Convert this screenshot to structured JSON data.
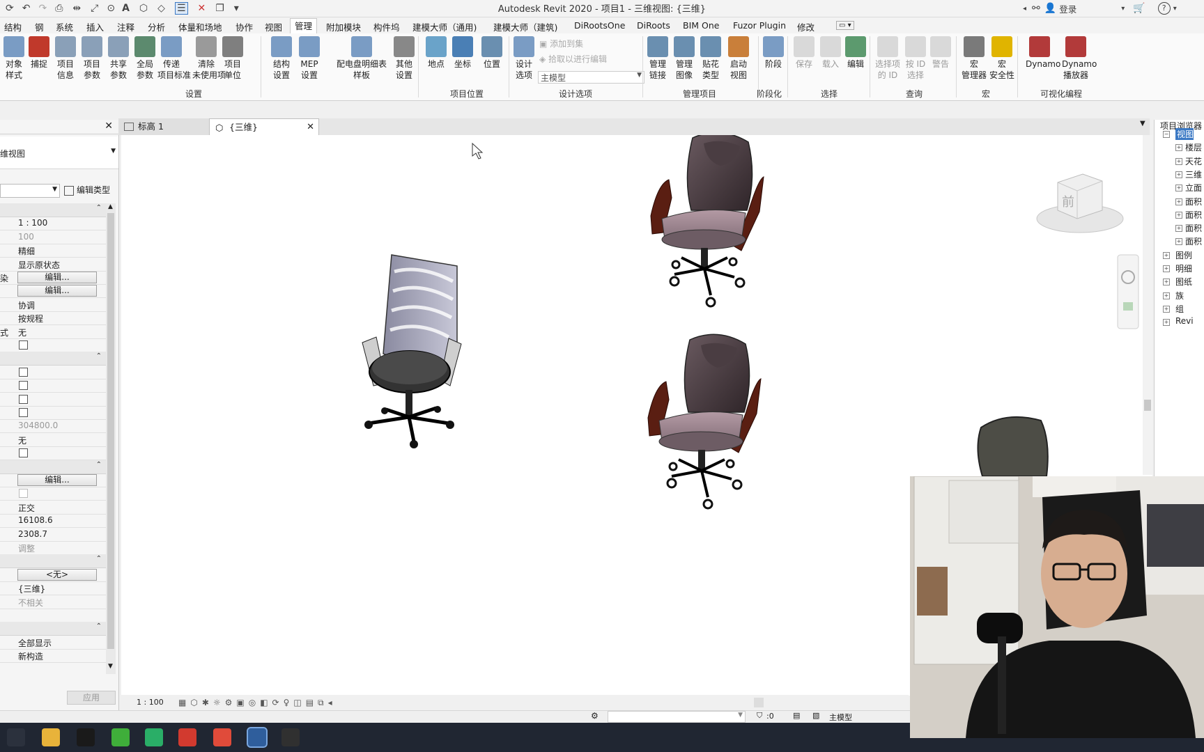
{
  "app": {
    "title": "Autodesk Revit 2020 - 项目1 - 三维视图: {三维}",
    "login_label": "登录"
  },
  "ribbon_tabs": [
    "结构",
    "钢",
    "系统",
    "插入",
    "注释",
    "分析",
    "体量和场地",
    "协作",
    "视图",
    "管理",
    "附加模块",
    "构件坞",
    "建模大师（通用)",
    "建模大师（建筑)",
    "DiRootsOne",
    "DiRoots",
    "BIM One",
    "Fuzor Plugin",
    "修改"
  ],
  "active_tab": "管理",
  "ribbon": {
    "buttons": [
      {
        "label": "对象\n样式",
        "color": "#7a9cc4"
      },
      {
        "label": "捕捉",
        "color": "#c0392b"
      },
      {
        "label": "项目\n信息",
        "color": "#8aa0b8"
      },
      {
        "label": "项目\n参数",
        "color": "#8aa0b8"
      },
      {
        "label": "共享\n参数",
        "color": "#8aa0b8"
      },
      {
        "label": "全局\n参数",
        "color": "#5c8a6e"
      },
      {
        "label": "传递\n项目标准",
        "color": "#7a9cc4"
      },
      {
        "label": "清除\n未使用项",
        "color": "#9a9a9a"
      },
      {
        "label": "项目\n单位",
        "color": "#7f7f7f"
      },
      {
        "label": "结构\n设置",
        "color": "#7a9cc4"
      },
      {
        "label": "MEP\n设置",
        "color": "#7a9cc4"
      },
      {
        "label": "配电盘明细表\n样板",
        "color": "#7a9cc4"
      },
      {
        "label": "其他\n设置",
        "color": "#888"
      },
      {
        "label": "地点",
        "color": "#6aa3c9"
      },
      {
        "label": "坐标",
        "color": "#4a7fb5"
      },
      {
        "label": "位置",
        "color": "#6a8fb0"
      },
      {
        "label": "设计\n选项",
        "color": "#7a9cc4"
      },
      {
        "label": "管理\n链接",
        "color": "#6a8fb0"
      },
      {
        "label": "管理\n图像",
        "color": "#6a8fb0"
      },
      {
        "label": "贴花\n类型",
        "color": "#6a8fb0"
      },
      {
        "label": "启动\n视图",
        "color": "#c97f3a"
      },
      {
        "label": "阶段",
        "color": "#7a9cc4"
      },
      {
        "label": "保存",
        "color": "#ccc",
        "disabled": true
      },
      {
        "label": "载入",
        "color": "#ccc",
        "disabled": true
      },
      {
        "label": "编辑",
        "color": "#5c9a6e"
      },
      {
        "label": "选择项\n的 ID",
        "color": "#ccc",
        "disabled": true
      },
      {
        "label": "按 ID\n选择",
        "color": "#ccc",
        "disabled": true
      },
      {
        "label": "警告",
        "color": "#ccc",
        "disabled": true
      },
      {
        "label": "宏\n管理器",
        "color": "#7a7a7a"
      },
      {
        "label": "宏\n安全性",
        "color": "#e0b400"
      },
      {
        "label": "Dynamo",
        "color": "#b23a3a"
      },
      {
        "label": "Dynamo\n播放器",
        "color": "#b23a3a"
      }
    ],
    "design_options": {
      "add_to_set": "添加到集",
      "pick_to_edit": "拾取以进行编辑",
      "main_model": "主模型"
    },
    "groups": [
      "设置",
      "项目位置",
      "设计选项",
      "管理项目",
      "阶段化",
      "选择",
      "查询",
      "宏",
      "可视化编程"
    ]
  },
  "view_tabs": [
    {
      "label": "标高 1",
      "icon": "floor-plan-icon",
      "active": false
    },
    {
      "label": "{三维}",
      "icon": "3d-view-icon",
      "active": true
    }
  ],
  "properties": {
    "type_label": "维视图",
    "edit_type_label": "编辑类型",
    "apply_label": "应用",
    "rows": [
      {
        "kind": "header"
      },
      {
        "key": "",
        "value": "1 : 100"
      },
      {
        "key": "",
        "value": "100",
        "grey": true
      },
      {
        "key": "",
        "value": "精细"
      },
      {
        "key": "",
        "value": "显示原状态"
      },
      {
        "key": "染",
        "value": "编辑...",
        "button": true
      },
      {
        "key": "",
        "value": "编辑...",
        "button": true
      },
      {
        "key": "",
        "value": "协调"
      },
      {
        "key": "",
        "value": "按规程"
      },
      {
        "key": "式",
        "value": "无"
      },
      {
        "key": "",
        "check": true
      },
      {
        "kind": "header"
      },
      {
        "key": "",
        "check": true
      },
      {
        "key": "",
        "check": true
      },
      {
        "key": "",
        "check": true
      },
      {
        "key": "",
        "check": true
      },
      {
        "key": "",
        "value": "304800.0",
        "grey": true
      },
      {
        "key": "",
        "value": "无"
      },
      {
        "key": "",
        "check": true
      },
      {
        "kind": "header"
      },
      {
        "key": "",
        "value": "编辑...",
        "button": true
      },
      {
        "key": "",
        "check": true,
        "dim": true
      },
      {
        "key": "",
        "value": "正交"
      },
      {
        "key": "",
        "value": "16108.6"
      },
      {
        "key": "",
        "value": "2308.7"
      },
      {
        "key": "",
        "value": "调整",
        "grey": true
      },
      {
        "kind": "header"
      },
      {
        "key": "",
        "value": "<无>",
        "button": true
      },
      {
        "key": "",
        "value": "{三维}"
      },
      {
        "key": "",
        "value": "不相关",
        "grey": true
      },
      {
        "key": "",
        "value": ""
      },
      {
        "kind": "header"
      },
      {
        "key": "",
        "value": "全部显示"
      },
      {
        "key": "",
        "value": "新构造"
      }
    ]
  },
  "project_browser": {
    "title": "项目浏览器",
    "items": [
      {
        "label": "视图",
        "indent": 0,
        "selected": true
      },
      {
        "label": "楼层",
        "indent": 1
      },
      {
        "label": "天花",
        "indent": 1
      },
      {
        "label": "三维",
        "indent": 1
      },
      {
        "label": "立面",
        "indent": 1
      },
      {
        "label": "面积",
        "indent": 1
      },
      {
        "label": "面积",
        "indent": 1
      },
      {
        "label": "面积",
        "indent": 1
      },
      {
        "label": "面积",
        "indent": 1
      },
      {
        "label": "图例",
        "indent": 0
      },
      {
        "label": "明细",
        "indent": 0
      },
      {
        "label": "图纸",
        "indent": 0
      },
      {
        "label": "族",
        "indent": 0
      },
      {
        "label": "组",
        "indent": 0
      },
      {
        "label": "Revi",
        "indent": 0
      }
    ]
  },
  "viewcube": {
    "face_label": "前"
  },
  "view_control_bar": {
    "scale": "1 : 100"
  },
  "status_bar": {
    "zero": ":0",
    "model": "主模型"
  },
  "taskbar_icons": [
    {
      "name": "task-view-icon",
      "color": "#2b313d"
    },
    {
      "name": "file-explorer-icon",
      "color": "#e8b33a"
    },
    {
      "name": "qq-icon",
      "color": "#1a1a1a"
    },
    {
      "name": "360-icon",
      "color": "#3fae3a"
    },
    {
      "name": "wechat-icon",
      "color": "#2aae67"
    },
    {
      "name": "wps-icon",
      "color": "#d23a2f"
    },
    {
      "name": "chrome-icon",
      "color": "#e04b3a"
    },
    {
      "name": "revit-icon",
      "color": "#2f5e9c"
    },
    {
      "name": "recorder-icon",
      "color": "#303030"
    }
  ]
}
